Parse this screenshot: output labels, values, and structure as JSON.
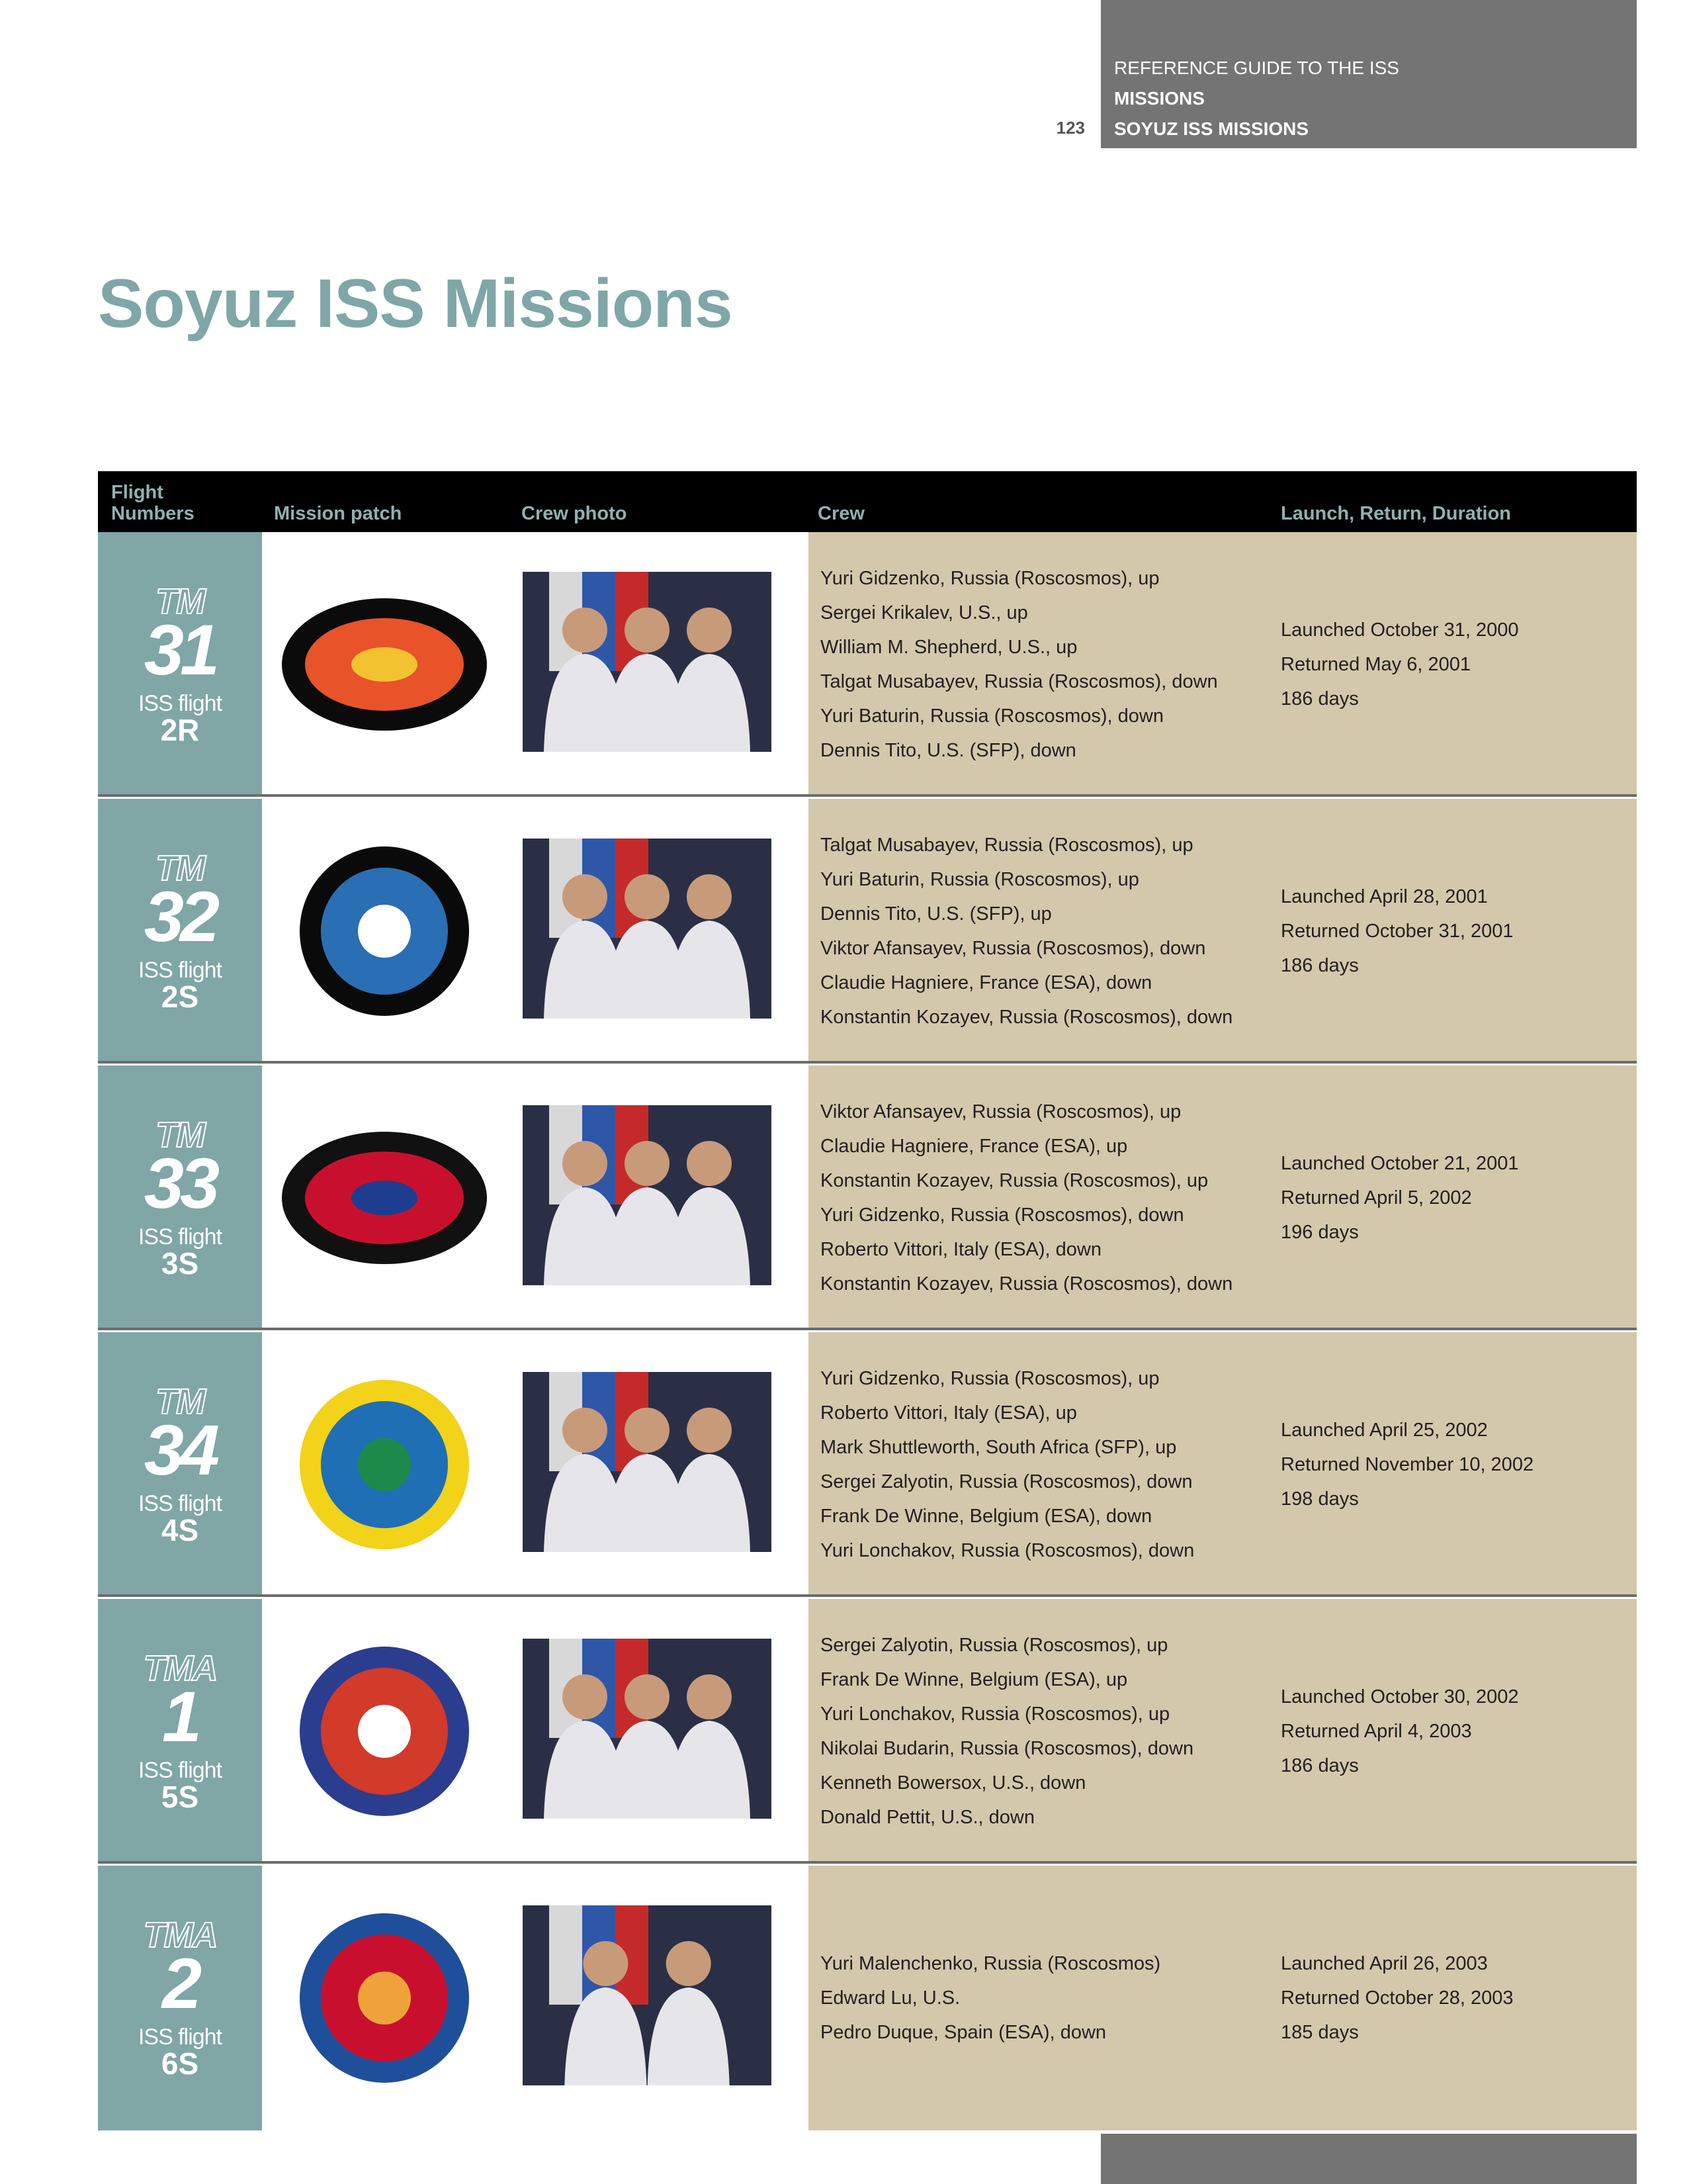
{
  "header": {
    "line1": "REFERENCE GUIDE TO THE ISS",
    "line2": "MISSIONS",
    "line3": "SOYUZ ISS MISSIONS",
    "page_number": "123"
  },
  "title": "Soyuz ISS Missions",
  "table": {
    "columns": {
      "flight_line1": "Flight",
      "flight_line2": "Numbers",
      "patch": "Mission patch",
      "photo": "Crew photo",
      "crew": "Crew",
      "launch": "Launch, Return, Duration"
    },
    "rows": [
      {
        "prefix": "TM",
        "number": "31",
        "iss_label": "ISS flight",
        "iss_code": "2R",
        "crew": [
          "Yuri Gidzenko, Russia (Roscosmos), up",
          "Sergei Krikalev, U.S., up",
          "William M. Shepherd, U.S., up",
          "Talgat Musabayev, Russia (Roscosmos), down",
          "Yuri Baturin, Russia (Roscosmos), down",
          "Dennis Tito, U.S. (SFP), down"
        ],
        "launch": [
          "Launched October 31, 2000",
          "Returned May 6, 2001",
          "186 days"
        ]
      },
      {
        "prefix": "TM",
        "number": "32",
        "iss_label": "ISS flight",
        "iss_code": "2S",
        "crew": [
          "Talgat Musabayev, Russia (Roscosmos), up",
          "Yuri Baturin, Russia (Roscosmos), up",
          "Dennis Tito, U.S. (SFP), up",
          "Viktor Afansayev, Russia (Roscosmos), down",
          "Claudie Hagniere, France (ESA), down",
          "Konstantin Kozayev, Russia (Roscosmos), down"
        ],
        "launch": [
          "Launched April 28, 2001",
          "Returned October 31, 2001",
          "186 days"
        ]
      },
      {
        "prefix": "TM",
        "number": "33",
        "iss_label": "ISS flight",
        "iss_code": "3S",
        "crew": [
          "Viktor Afansayev, Russia (Roscosmos), up",
          "Claudie Hagniere, France (ESA), up",
          "Konstantin Kozayev, Russia (Roscosmos), up",
          "Yuri Gidzenko, Russia (Roscosmos), down",
          "Roberto Vittori, Italy (ESA), down",
          "Konstantin Kozayev, Russia (Roscosmos), down"
        ],
        "launch": [
          "Launched October 21, 2001",
          "Returned April 5, 2002",
          "196 days"
        ]
      },
      {
        "prefix": "TM",
        "number": "34",
        "iss_label": "ISS flight",
        "iss_code": "4S",
        "crew": [
          "Yuri Gidzenko, Russia (Roscosmos), up",
          "Roberto Vittori, Italy (ESA), up",
          "Mark Shuttleworth, South Africa (SFP), up",
          "Sergei Zalyotin, Russia (Roscosmos), down",
          "Frank De Winne, Belgium (ESA), down",
          "Yuri Lonchakov, Russia (Roscosmos), down"
        ],
        "launch": [
          "Launched April 25, 2002",
          "Returned November 10, 2002",
          "198 days"
        ]
      },
      {
        "prefix": "TMA",
        "number": "1",
        "iss_label": "ISS flight",
        "iss_code": "5S",
        "crew": [
          "Sergei Zalyotin, Russia (Roscosmos), up",
          "Frank De Winne, Belgium (ESA), up",
          "Yuri Lonchakov, Russia (Roscosmos), up",
          "Nikolai Budarin, Russia (Roscosmos), down",
          "Kenneth Bowersox, U.S., down",
          "Donald Pettit, U.S., down"
        ],
        "launch": [
          "Launched October 30, 2002",
          "Returned April 4, 2003",
          "186 days"
        ]
      },
      {
        "prefix": "TMA",
        "number": "2",
        "iss_label": "ISS flight",
        "iss_code": "6S",
        "crew": [
          "Yuri Malenchenko, Russia (Roscosmos)",
          "Edward Lu, U.S.",
          "Pedro Duque, Spain (ESA), down"
        ],
        "launch": [
          "Launched April 26, 2003",
          "Returned October 28, 2003",
          "185 days"
        ]
      }
    ]
  }
}
